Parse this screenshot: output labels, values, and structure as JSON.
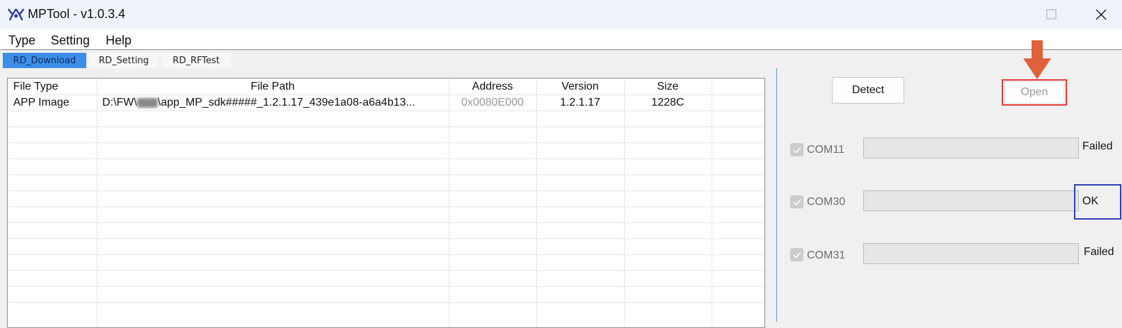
{
  "window": {
    "title": "MPTool - v1.0.3.4",
    "minimize_label": "–",
    "maximize_label": "☐",
    "close_label": "✕"
  },
  "menu": [
    "Type",
    "Setting",
    "Help"
  ],
  "tabs": [
    {
      "label": "RD_Download",
      "active": true
    },
    {
      "label": "RD_Setting",
      "active": false
    },
    {
      "label": "RD_RFTest",
      "active": false
    }
  ],
  "table": {
    "columns": [
      "File Type",
      "File Path",
      "Address",
      "Version",
      "Size"
    ],
    "rows": [
      {
        "file_type": "APP Image",
        "file_path_prefix": "D:\\FW\\",
        "file_path_suffix": "\\app_MP_sdk#####_1.2.1.17_439e1a08-a6a4b13...",
        "address": "0x0080E000",
        "version": "1.2.1.17",
        "size": "1228C"
      }
    ]
  },
  "buttons": {
    "detect": "Detect",
    "open": "Open"
  },
  "ports": [
    {
      "name": "COM11",
      "checked": true,
      "progress": 0,
      "status": "Failed"
    },
    {
      "name": "COM30",
      "checked": true,
      "progress": 0,
      "status": "OK"
    },
    {
      "name": "COM31",
      "checked": true,
      "progress": 0,
      "status": "Failed"
    }
  ],
  "colors": {
    "active_tab": "#3d8ee8",
    "highlight_red": "#e23b3b",
    "highlight_blue": "#2c3fb4",
    "arrow": "#e0623a"
  }
}
